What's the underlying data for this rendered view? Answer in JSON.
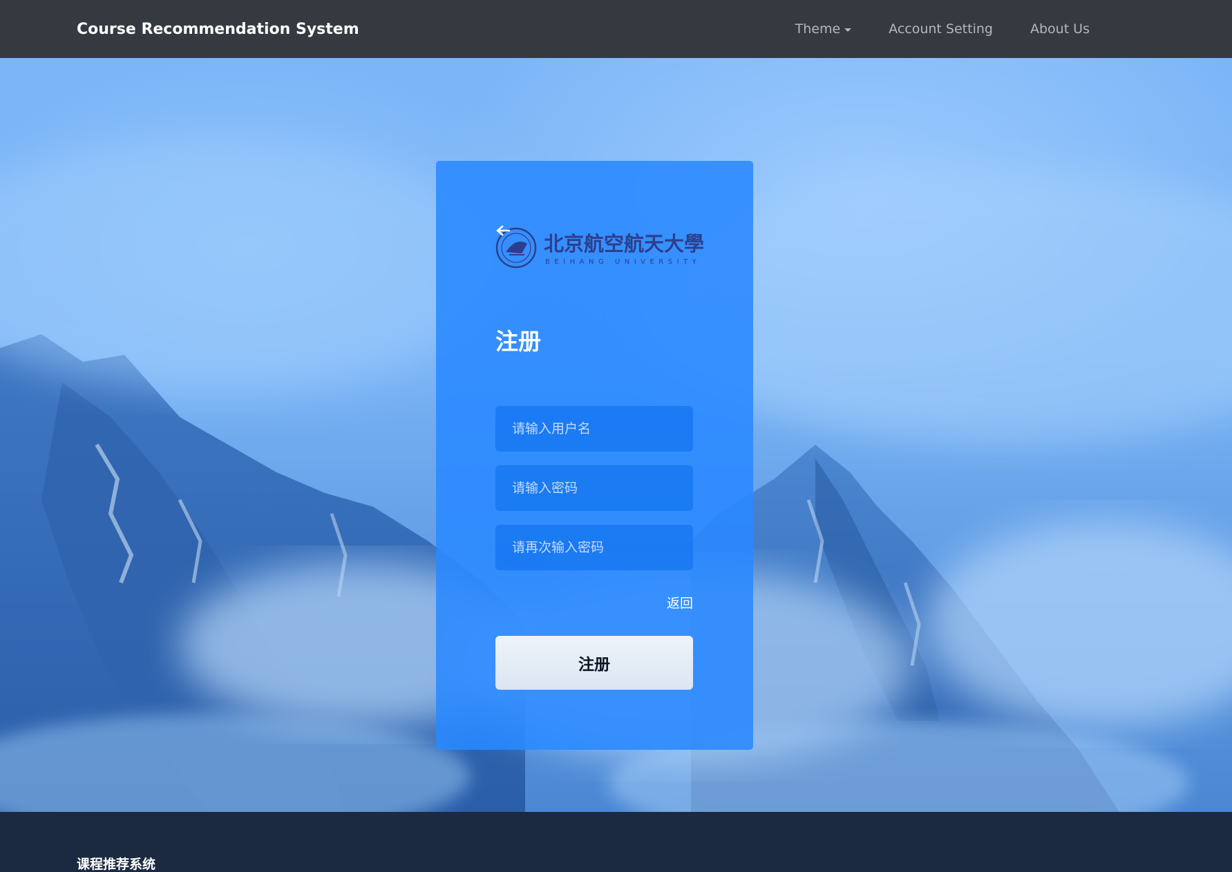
{
  "navbar": {
    "brand": "Course Recommendation System",
    "links": [
      {
        "label": "Theme"
      },
      {
        "label": "Account Setting"
      },
      {
        "label": "About Us"
      }
    ]
  },
  "register_card": {
    "logo": {
      "name_cn": "北京航空航天大學",
      "name_en": "BEIHANG UNIVERSITY"
    },
    "title": "注册",
    "username": {
      "placeholder": "请输入用户名",
      "value": ""
    },
    "password": {
      "placeholder": "请输入密码",
      "value": ""
    },
    "password_confirm": {
      "placeholder": "请再次输入密码",
      "value": ""
    },
    "back_label": "返回",
    "submit_label": "注册"
  },
  "footer": {
    "title": "课程推荐系统"
  },
  "colors": {
    "navbar_bg": "#343a40",
    "card_bg": "#2a89ff",
    "footer_bg": "#1b2a40",
    "logo_ink": "#2d3f8c"
  }
}
